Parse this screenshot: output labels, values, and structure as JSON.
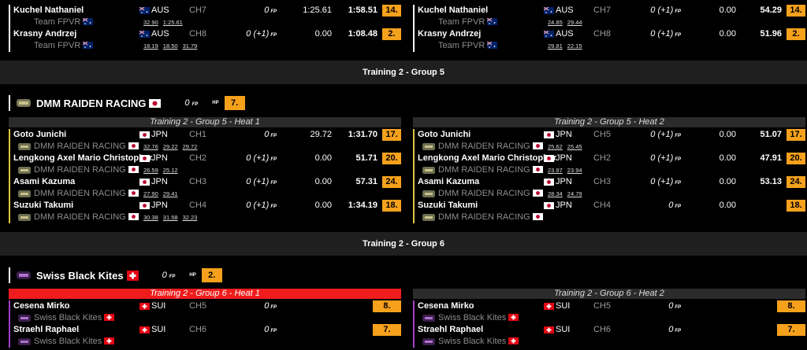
{
  "colors": {
    "accent": "#f5a11c",
    "divider": "#1f1f1f",
    "heat_header": "#2b2b2b",
    "heat_header_active": "#ee1c1c",
    "raiden_bar": "#e0c43a",
    "kites_bar": "#a040c8"
  },
  "fp_unit": "FP",
  "hp_label": "HP",
  "top_left": [
    {
      "name": "Kuchel Nathaniel",
      "country": "AUS",
      "flag": "au-flag",
      "ch": "CH7",
      "fp": "0",
      "t1": "1:25.61",
      "t2": "1:58.51",
      "pos": "14.",
      "team": "Team FPVR",
      "laps": [
        "32.90",
        "1:25.61"
      ]
    },
    {
      "name": "Krasny Andrzej",
      "country": "AUS",
      "flag": "au-flag",
      "ch": "CH8",
      "fp": "0 (+1)",
      "t1": "0.00",
      "t2": "1:08.48",
      "pos": "2.",
      "team": "Team FPVR",
      "laps": [
        "18.19",
        "18.50",
        "31.79"
      ]
    }
  ],
  "top_right": [
    {
      "name": "Kuchel Nathaniel",
      "country": "AUS",
      "flag": "au-flag",
      "ch": "CH7",
      "fp": "0 (+1)",
      "t1": "0.00",
      "t2": "54.29",
      "pos": "14.",
      "team": "Team FPVR",
      "laps": [
        "24.85",
        "29.44"
      ]
    },
    {
      "name": "Krasny Andrzej",
      "country": "AUS",
      "flag": "au-flag",
      "ch": "CH8",
      "fp": "0 (+1)",
      "t1": "0.00",
      "t2": "51.96",
      "pos": "2.",
      "team": "Team FPVR",
      "laps": [
        "29.81",
        "22.15"
      ]
    }
  ],
  "group5": {
    "title": "Training 2 - Group 5",
    "team": {
      "name": "DMM RAIDEN RACING",
      "fp": "0",
      "pos": "7."
    },
    "heat1": {
      "title": "Training 2 - Group 5 - Heat 1",
      "rows": [
        {
          "name": "Goto Junichi",
          "country": "JPN",
          "ch": "CH1",
          "fp": "0",
          "t1": "29.72",
          "t2": "1:31.70",
          "pos": "17.",
          "team": "DMM RAIDEN RACING",
          "laps": [
            "32.76",
            "29.22",
            "29.72"
          ]
        },
        {
          "name": "Lengkong Axel Mario Christopher",
          "country": "JPN",
          "ch": "CH2",
          "fp": "0 (+1)",
          "t1": "0.00",
          "t2": "51.71",
          "pos": "20.",
          "team": "DMM RAIDEN RACING",
          "laps": [
            "26.59",
            "25.12"
          ]
        },
        {
          "name": "Asami Kazuma",
          "country": "JPN",
          "ch": "CH3",
          "fp": "0 (+1)",
          "t1": "0.00",
          "t2": "57.31",
          "pos": "24.",
          "team": "DMM RAIDEN RACING",
          "laps": [
            "27.90",
            "29.41"
          ]
        },
        {
          "name": "Suzuki Takumi",
          "country": "JPN",
          "ch": "CH4",
          "fp": "0 (+1)",
          "t1": "0.00",
          "t2": "1:34.19",
          "pos": "18.",
          "team": "DMM RAIDEN RACING",
          "laps": [
            "30.38",
            "31.58",
            "32.23"
          ]
        }
      ]
    },
    "heat2": {
      "title": "Training 2 - Group 5 - Heat 2",
      "rows": [
        {
          "name": "Goto Junichi",
          "country": "JPN",
          "ch": "CH5",
          "fp": "0 (+1)",
          "t1": "0.00",
          "t2": "51.07",
          "pos": "17.",
          "team": "DMM RAIDEN RACING",
          "laps": [
            "25.62",
            "25.45"
          ]
        },
        {
          "name": "Lengkong Axel Mario Christopher",
          "country": "JPN",
          "ch": "CH2",
          "fp": "0 (+1)",
          "t1": "0.00",
          "t2": "47.91",
          "pos": "20.",
          "team": "DMM RAIDEN RACING",
          "laps": [
            "23.97",
            "23.94"
          ]
        },
        {
          "name": "Asami Kazuma",
          "country": "JPN",
          "ch": "CH3",
          "fp": "0 (+1)",
          "t1": "0.00",
          "t2": "53.13",
          "pos": "24.",
          "team": "DMM RAIDEN RACING",
          "laps": [
            "28.34",
            "24.79"
          ]
        },
        {
          "name": "Suzuki Takumi",
          "country": "JPN",
          "ch": "CH4",
          "fp": "0",
          "t1": "0.00",
          "t2": "",
          "pos": "18.",
          "team": "DMM RAIDEN RACING",
          "laps": []
        }
      ]
    }
  },
  "group6": {
    "title": "Training 2 - Group 6",
    "team": {
      "name": "Swiss Black Kites",
      "fp": "0",
      "pos": "2."
    },
    "heat1": {
      "title": "Training 2 - Group 6 - Heat 1",
      "rows": [
        {
          "name": "Cesena Mirko",
          "country": "SUI",
          "ch": "CH5",
          "fp": "0",
          "pos": "8.",
          "team": "Swiss Black Kites"
        },
        {
          "name": "Straehl Raphael",
          "country": "SUI",
          "ch": "CH6",
          "fp": "0",
          "pos": "7.",
          "team": "Swiss Black Kites"
        }
      ]
    },
    "heat2": {
      "title": "Training 2 - Group 6 - Heat 2",
      "rows": [
        {
          "name": "Cesena Mirko",
          "country": "SUI",
          "ch": "CH5",
          "fp": "0",
          "pos": "8.",
          "team": "Swiss Black Kites"
        },
        {
          "name": "Straehl Raphael",
          "country": "SUI",
          "ch": "CH6",
          "fp": "0",
          "pos": "7.",
          "team": "Swiss Black Kites"
        }
      ]
    }
  }
}
